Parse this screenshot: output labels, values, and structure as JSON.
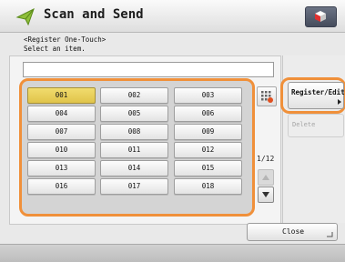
{
  "header": {
    "title": "Scan and Send",
    "app_icon": "send-arrow-icon",
    "right_icon": "settings-cube-icon"
  },
  "instructions": {
    "line1": "<Register One-Touch>",
    "line2": "Select an item."
  },
  "name_field": {
    "value": ""
  },
  "grid": {
    "selected": "001",
    "items": [
      "001",
      "002",
      "003",
      "004",
      "005",
      "006",
      "007",
      "008",
      "009",
      "010",
      "011",
      "012",
      "013",
      "014",
      "015",
      "016",
      "017",
      "018"
    ]
  },
  "pager": {
    "label": "1/12"
  },
  "side": {
    "register_label": "Register/Edit",
    "delete_label": "Delete"
  },
  "close_label": "Close",
  "colors": {
    "highlight_outline": "#f0903a",
    "selected_item": "#e6cc55"
  }
}
